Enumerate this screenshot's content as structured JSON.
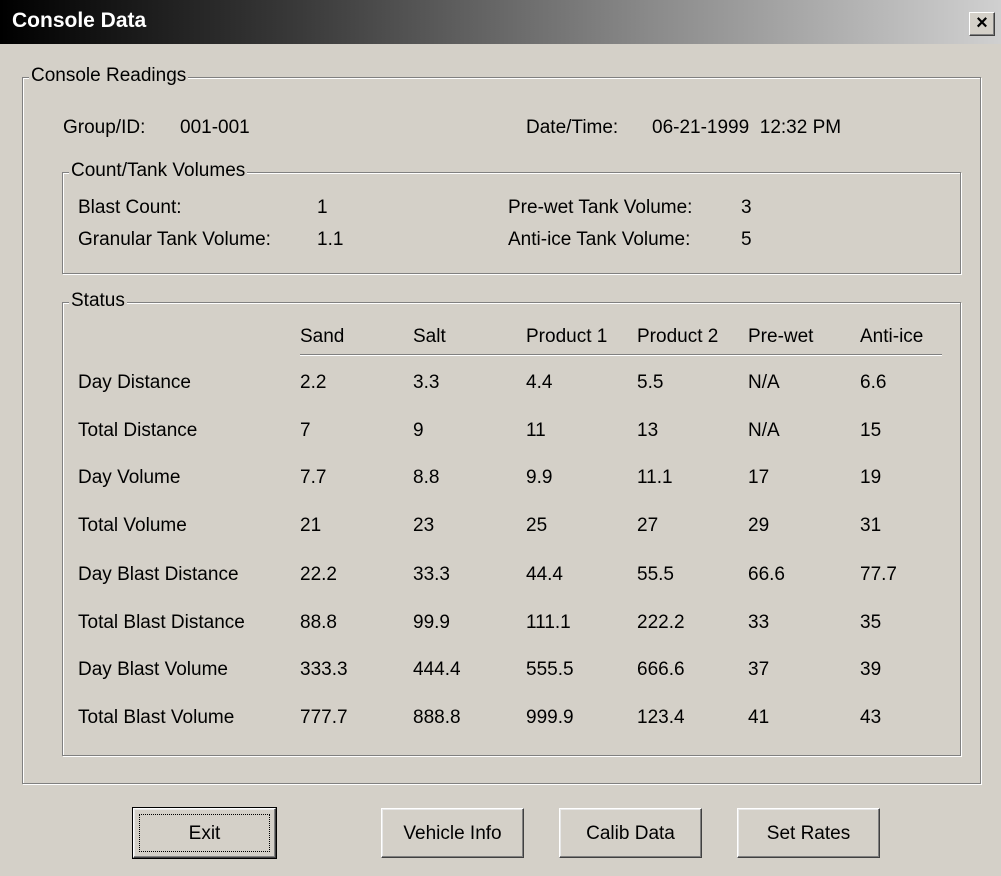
{
  "window": {
    "title": "Console Data",
    "close_glyph": "×"
  },
  "console_readings": {
    "legend": "Console Readings",
    "group_id_label": "Group/ID:",
    "group_id_value": "001-001",
    "datetime_label": "Date/Time:",
    "datetime_value": "06-21-1999  12:32 PM"
  },
  "tank_volumes": {
    "legend": "Count/Tank Volumes",
    "blast_count_label": "Blast Count:",
    "blast_count_value": "1",
    "granular_label": "Granular Tank Volume:",
    "granular_value": "1.1",
    "prewet_label": "Pre-wet Tank Volume:",
    "prewet_value": "3",
    "antiice_label": "Anti-ice Tank Volume:",
    "antiice_value": "5"
  },
  "status": {
    "legend": "Status",
    "columns": [
      "Sand",
      "Salt",
      "Product 1",
      "Product 2",
      "Pre-wet",
      "Anti-ice"
    ],
    "rows": [
      {
        "label": "Day Distance",
        "values": [
          "2.2",
          "3.3",
          "4.4",
          "5.5",
          "N/A",
          "6.6"
        ]
      },
      {
        "label": "Total Distance",
        "values": [
          "7",
          "9",
          "11",
          "13",
          "N/A",
          "15"
        ]
      },
      {
        "label": "Day Volume",
        "values": [
          "7.7",
          "8.8",
          "9.9",
          "11.1",
          "17",
          "19"
        ]
      },
      {
        "label": "Total Volume",
        "values": [
          "21",
          "23",
          "25",
          "27",
          "29",
          "31"
        ]
      },
      {
        "label": "Day Blast Distance",
        "values": [
          "22.2",
          "33.3",
          "44.4",
          "55.5",
          "66.6",
          "77.7"
        ]
      },
      {
        "label": "Total Blast Distance",
        "values": [
          "88.8",
          "99.9",
          "111.1",
          "222.2",
          "33",
          "35"
        ]
      },
      {
        "label": "Day Blast Volume",
        "values": [
          "333.3",
          "444.4",
          "555.5",
          "666.6",
          "37",
          "39"
        ]
      },
      {
        "label": "Total Blast Volume",
        "values": [
          "777.7",
          "888.8",
          "999.9",
          "123.4",
          "41",
          "43"
        ]
      }
    ]
  },
  "buttons": {
    "exit": "Exit",
    "vehicle_info": "Vehicle Info",
    "calib_data": "Calib Data",
    "set_rates": "Set Rates"
  }
}
